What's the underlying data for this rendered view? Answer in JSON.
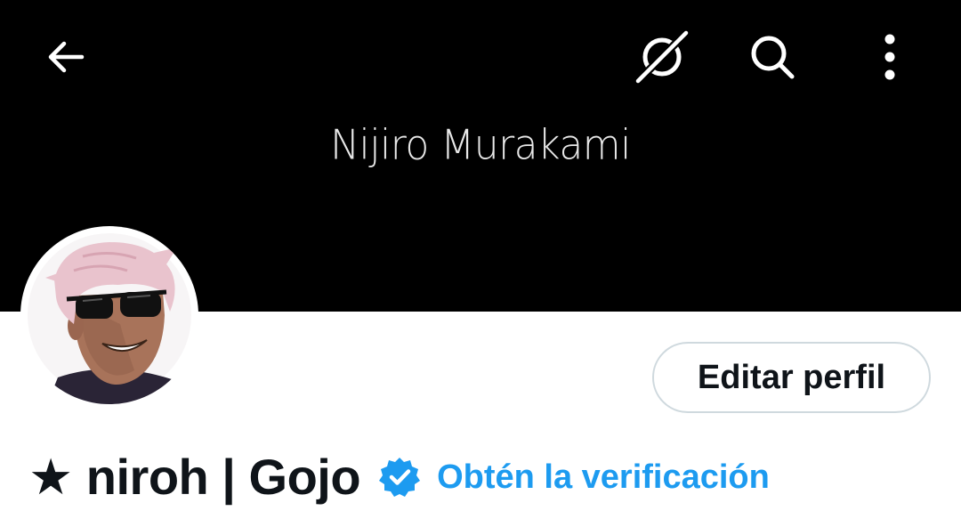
{
  "banner": {
    "text": "Nijiro Murakami",
    "background": "#000000"
  },
  "header": {
    "icons": [
      "back-arrow-icon",
      "grok-icon",
      "search-icon",
      "more-vertical-icon"
    ]
  },
  "profile": {
    "display_name": "★ niroh | Gojo",
    "edit_button_label": "Editar perfil",
    "verify_link_label": "Obtén la verificación",
    "verified_badge_icon": "verified-badge-icon"
  },
  "colors": {
    "accent": "#1d9bf0",
    "text": "#0f1419",
    "border": "#cfd9de"
  }
}
